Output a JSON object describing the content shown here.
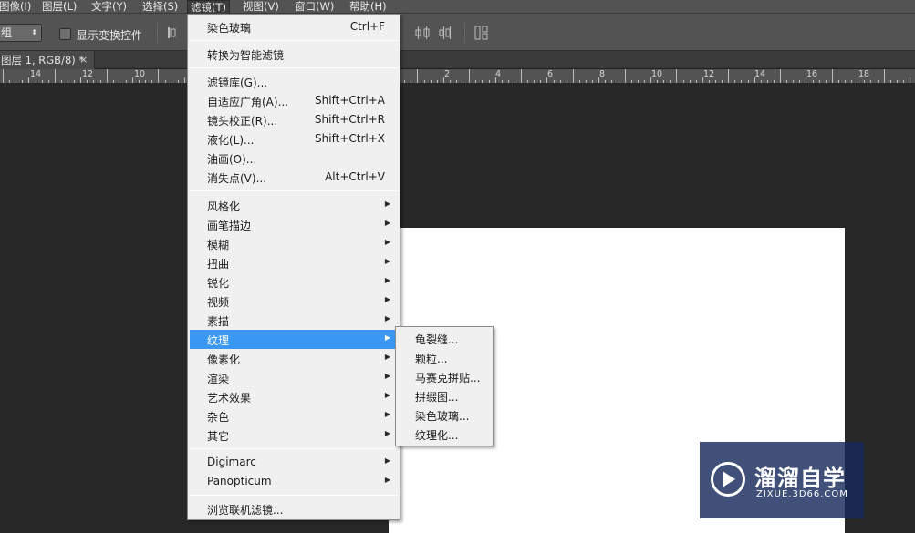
{
  "menubar": {
    "items": [
      "图像(I)",
      "图层(L)",
      "文字(Y)",
      "选择(S)",
      "滤镜(T)",
      "视图(V)",
      "窗口(W)",
      "帮助(H)"
    ]
  },
  "options": {
    "combo_value": "组",
    "checkbox_label": "显示变换控件"
  },
  "document_tab": {
    "title": "图层 1, RGB/8) *",
    "close": "×"
  },
  "ruler": {
    "labels": [
      "14",
      "12",
      "10",
      "2",
      "4",
      "6",
      "8",
      "10",
      "12",
      "14",
      "16",
      "18"
    ]
  },
  "filter_menu": {
    "items": [
      {
        "label": "染色玻璃",
        "shortcut": "Ctrl+F"
      },
      {
        "label": "转换为智能滤镜"
      },
      {
        "label": "滤镜库(G)..."
      },
      {
        "label": "自适应广角(A)...",
        "shortcut": "Shift+Ctrl+A"
      },
      {
        "label": "镜头校正(R)...",
        "shortcut": "Shift+Ctrl+R"
      },
      {
        "label": "液化(L)...",
        "shortcut": "Shift+Ctrl+X"
      },
      {
        "label": "油画(O)..."
      },
      {
        "label": "消失点(V)...",
        "shortcut": "Alt+Ctrl+V"
      },
      {
        "label": "风格化"
      },
      {
        "label": "画笔描边"
      },
      {
        "label": "模糊"
      },
      {
        "label": "扭曲"
      },
      {
        "label": "锐化"
      },
      {
        "label": "视频"
      },
      {
        "label": "素描"
      },
      {
        "label": "纹理"
      },
      {
        "label": "像素化"
      },
      {
        "label": "渲染"
      },
      {
        "label": "艺术效果"
      },
      {
        "label": "杂色"
      },
      {
        "label": "其它"
      },
      {
        "label": "Digimarc"
      },
      {
        "label": "Panopticum"
      },
      {
        "label": "浏览联机滤镜..."
      }
    ],
    "submenu_arrow": "▶"
  },
  "texture_submenu": {
    "items": [
      "龟裂缝...",
      "颗粒...",
      "马赛克拼贴...",
      "拼缀图...",
      "染色玻璃...",
      "纹理化..."
    ]
  },
  "watermark": {
    "title": "溜溜自学",
    "url": "ZIXUE.3D66.COM"
  },
  "colors": {
    "highlight": "#3a98f2",
    "menu_bg": "#f0f0f0",
    "app_bg": "#282828"
  }
}
